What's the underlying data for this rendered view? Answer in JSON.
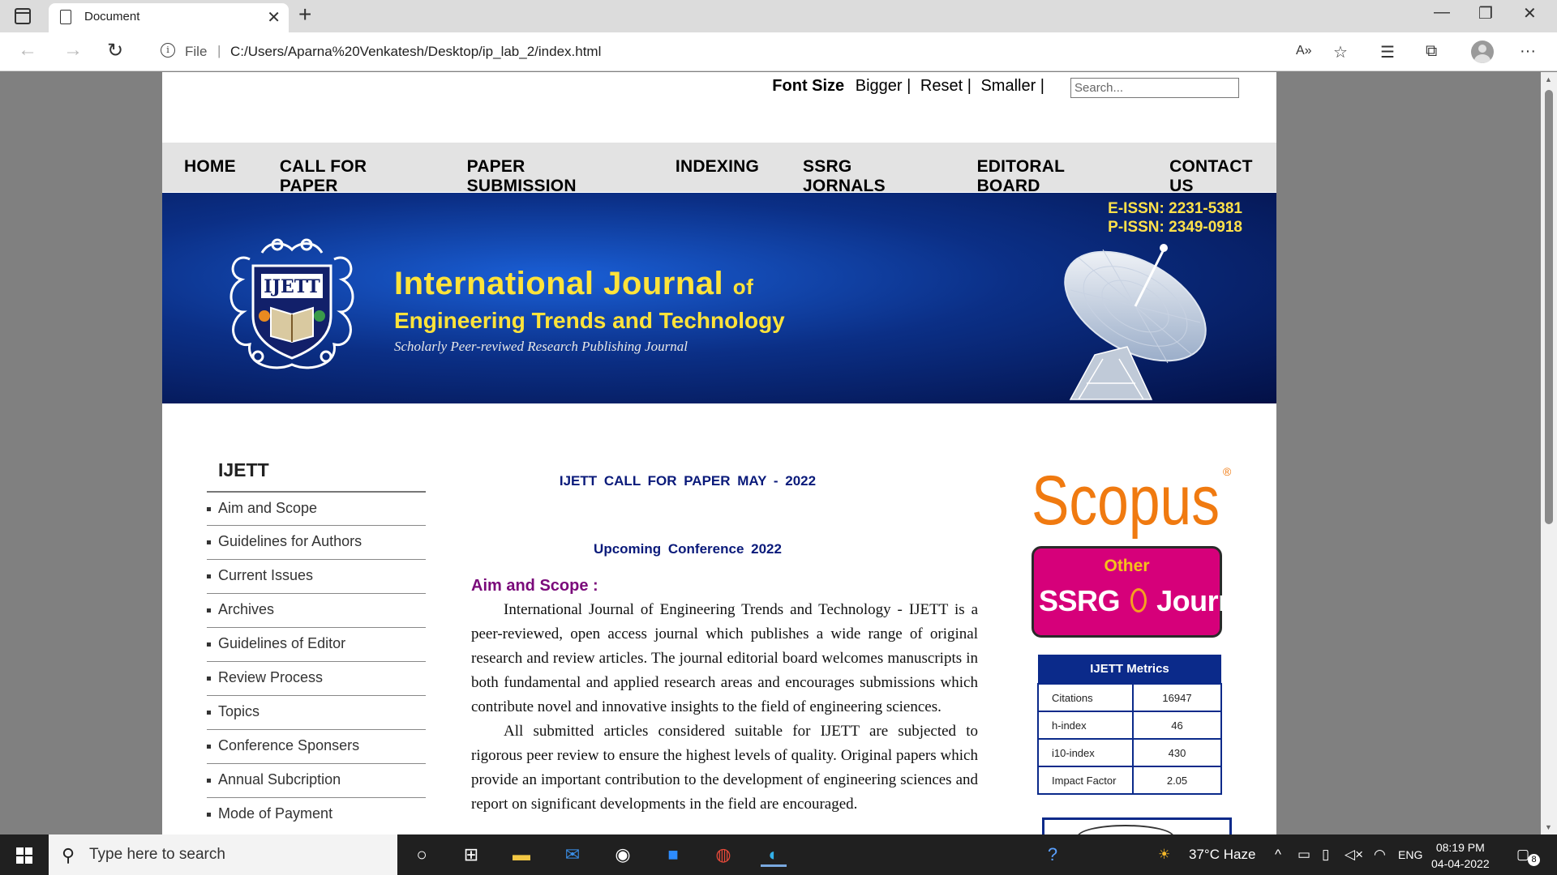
{
  "browser": {
    "tab_title": "Document",
    "url_scheme_label": "File",
    "url_separator": "|",
    "url": "C:/Users/Aparna%20Venkatesh/Desktop/ip_lab_2/index.html"
  },
  "page": {
    "font_size": {
      "label": "Font Size",
      "bigger": "Bigger |",
      "reset": "Reset |",
      "smaller": "Smaller |"
    },
    "search_placeholder": "Search...",
    "menu": [
      "HOME",
      "CALL FOR PAPER",
      "PAPER SUBMISSION",
      "INDEXING",
      "SSRG JORNALS",
      "EDITORAL BOARD",
      "CONTACT US"
    ],
    "banner": {
      "eissn": "E-ISSN: 2231-5381",
      "pissn": "P-ISSN: 2349-0918",
      "logo_text": "IJETT",
      "title_main": "International Journal",
      "title_of": "of",
      "title_sub": "Engineering Trends and Technology",
      "tagline": "Scholarly Peer-reviwed Research Publishing Journal"
    },
    "sidebar": {
      "title": "IJETT",
      "items": [
        "Aim and Scope",
        "Guidelines for Authors",
        "Current Issues",
        "Archives",
        "Guidelines of Editor",
        "Review Process",
        "Topics",
        "Conference Sponsers",
        "Annual Subcription",
        "Mode of Payment"
      ]
    },
    "main": {
      "call_for_paper": "IJETT CALL FOR PAPER MAY - 2022",
      "upcoming": "Upcoming Conference 2022",
      "aim_heading": "Aim and Scope :",
      "para1": "International Journal of Engineering Trends and Technology - IJETT is a peer-reviewed, open access journal which publishes a wide range of original research and review articles. The journal editorial board welcomes manuscripts in both fundamental and applied research areas and encourages submissions which contribute novel and innovative insights to the field of engineering sciences.",
      "para2": "All submitted articles considered suitable for IJETT are subjected to rigorous peer review to ensure the highest levels of quality. Original papers which provide an important contribution to the development of engineering sciences and report on significant developments in the field are encouraged."
    },
    "right": {
      "scopus": "Scopus",
      "scopus_mark": "®",
      "ssrg_other": "Other",
      "ssrg_name_left": "SSRG",
      "ssrg_name_right": "Journals",
      "metrics_title": "IJETT Metrics",
      "metrics": [
        {
          "label": "Citations",
          "value": "16947"
        },
        {
          "label": "h-index",
          "value": "46"
        },
        {
          "label": "i10-index",
          "value": "430"
        },
        {
          "label": "Impact Factor",
          "value": "2.05"
        }
      ]
    }
  },
  "taskbar": {
    "search_placeholder": "Type here to search",
    "weather": "37°C Haze",
    "lang": "ENG",
    "time": "08:19 PM",
    "date": "04-04-2022",
    "notifications": "8"
  },
  "colors": {
    "menu_bg": "#e3e3e3",
    "banner_dark": "#031046",
    "heading_blue": "#0a1a7a",
    "aim_purple": "#7a0a7a",
    "scopus_orange": "#f07a10",
    "ssrg_pink": "#d6007a",
    "metrics_blue": "#0b2a8a"
  }
}
